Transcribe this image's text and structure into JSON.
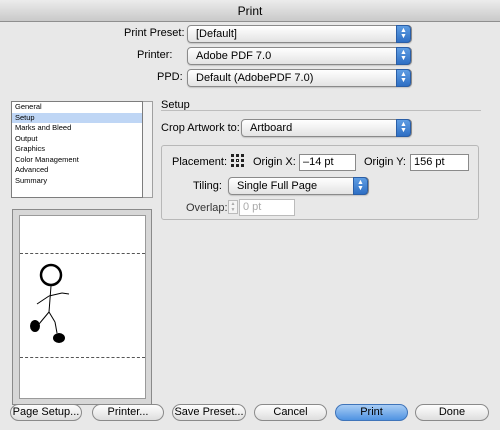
{
  "window": {
    "title": "Print"
  },
  "print_preset": {
    "label": "Print Preset:",
    "value": "[Default]"
  },
  "printer": {
    "label": "Printer:",
    "value": "Adobe PDF 7.0"
  },
  "ppd": {
    "label": "PPD:",
    "value": "Default (AdobePDF 7.0)"
  },
  "sidebar": {
    "items": [
      {
        "label": "General"
      },
      {
        "label": "Setup"
      },
      {
        "label": "Marks and Bleed"
      },
      {
        "label": "Output"
      },
      {
        "label": "Graphics"
      },
      {
        "label": "Color Management"
      },
      {
        "label": "Advanced"
      },
      {
        "label": "Summary"
      }
    ],
    "selected": "Setup"
  },
  "setup": {
    "title": "Setup",
    "crop_artwork": {
      "label": "Crop Artwork to:",
      "value": "Artboard"
    },
    "placement": {
      "label": "Placement:"
    },
    "origin_x": {
      "label": "Origin X:",
      "value": "–14 pt"
    },
    "origin_y": {
      "label": "Origin Y:",
      "value": "156 pt"
    },
    "tiling": {
      "label": "Tiling:",
      "value": "Single Full Page"
    },
    "overlap": {
      "label": "Overlap:",
      "value": "0 pt"
    }
  },
  "buttons": {
    "page_setup": "Page Setup...",
    "printer": "Printer...",
    "save_preset": "Save Preset...",
    "cancel": "Cancel",
    "print": "Print",
    "done": "Done"
  },
  "colors": {
    "accent": "#4f93e2",
    "selection": "#bfd6f5"
  }
}
